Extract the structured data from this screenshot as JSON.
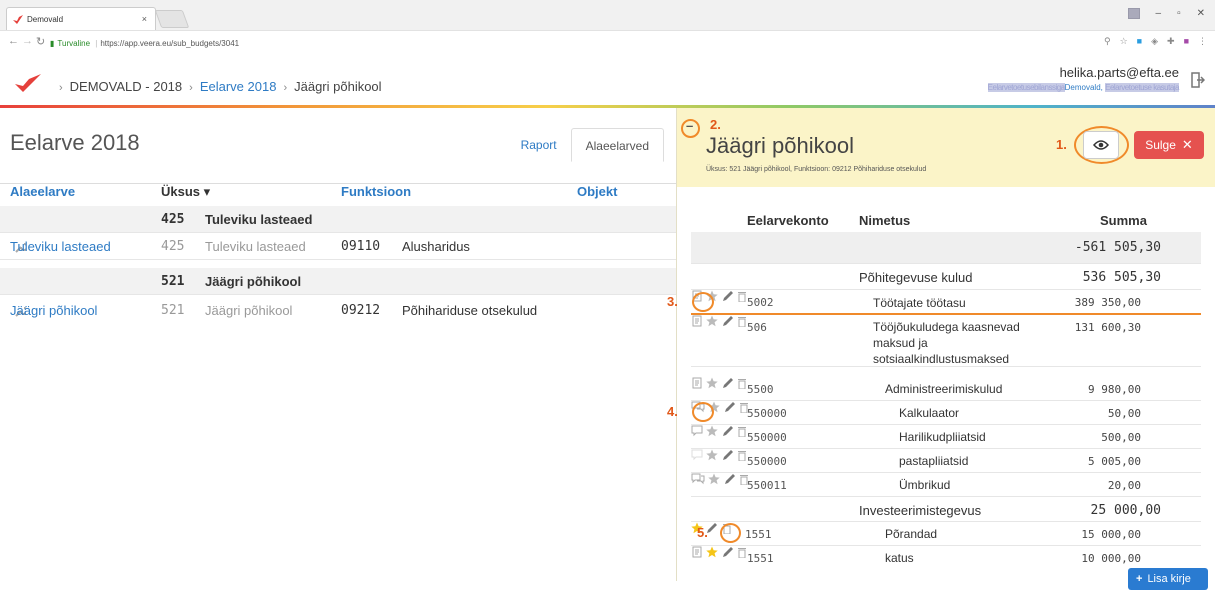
{
  "browser": {
    "tab_title": "Demovald",
    "tab_close": "×",
    "secure_label": "Turvaline",
    "url": "https://app.veera.eu/sub_budgets/3041"
  },
  "header": {
    "crumbs": [
      "DEMOVALD - 2018",
      "Eelarve 2018",
      "Jäägri põhikool"
    ],
    "user_email": "helika.parts@efta.ee",
    "user_org_blur_left": "Eelarvetoetusebilanssiga",
    "user_org": "Demovald,",
    "user_org_blur_right": "Eelarvetoetuse kasutaja"
  },
  "left": {
    "title": "Eelarve 2018",
    "tabs": [
      "Raport",
      "Alaeelarved"
    ],
    "columns": {
      "alaeelarve": "Alaeelarve",
      "uksus": "Üksus ▾",
      "funktsioon": "Funktsioon",
      "objekt": "Objekt"
    },
    "rows": [
      {
        "type": "group",
        "code": "425",
        "name": "Tuleviku lasteaed"
      },
      {
        "type": "item",
        "alaeelarve": "Tuleviku lasteaed",
        "code": "425",
        "name": "Tuleviku lasteaed",
        "fcode": "09110",
        "fname": "Alusharidus"
      },
      {
        "type": "group",
        "code": "521",
        "name": "Jäägri põhikool"
      },
      {
        "type": "item",
        "alaeelarve": "Jäägri põhikool",
        "code": "521",
        "name": "Jäägri põhikool",
        "fcode": "09212",
        "fname": "Põhihariduse otsekulud"
      }
    ]
  },
  "right": {
    "title": "Jäägri põhikool",
    "subtitle": "Üksus: 521 Jäägri põhikool, Funktsioon: 09212 Põhihariduse otsekulud",
    "close_label": "Sulge",
    "annotations": {
      "a1": "1.",
      "a2": "2.",
      "a3": "3.",
      "a4": "4.",
      "a5": "5."
    },
    "columns": {
      "konto": "Eelarvekonto",
      "nimetus": "Nimetus",
      "summa": "Summa"
    },
    "total": "-561 505,30",
    "group1": {
      "name": "Põhitegevuse kulud",
      "amount": "536 505,30"
    },
    "group2": {
      "name": "Investeerimistegevus",
      "amount": "25 000,00"
    },
    "rows": [
      {
        "code": "5002",
        "name": "Töötajate töötasu",
        "amount": "389 350,00",
        "icon": "document-icon",
        "starred": false
      },
      {
        "code": "506",
        "name": "Tööjõukuludega kaasnevad maksud ja sotsiaalkindlustusmaksed",
        "amount": "131 600,30",
        "icon": "document-icon",
        "starred": false
      },
      {
        "code": "5500",
        "name": "Administreerimiskulud",
        "amount": "9 980,00",
        "icon": "document-icon",
        "starred": false
      },
      {
        "code": "550000",
        "name": "Kalkulaator",
        "amount": "50,00",
        "icon": "comments-icon",
        "starred": false
      },
      {
        "code": "550000",
        "name": "Harilikudpliiatsid",
        "amount": "500,00",
        "icon": "comment-icon",
        "starred": false
      },
      {
        "code": "550000",
        "name": "pastapliiatsid",
        "amount": "5 005,00",
        "icon": "comment-empty-icon",
        "starred": false
      },
      {
        "code": "550011",
        "name": "Ümbrikud",
        "amount": "20,00",
        "icon": "comments-icon",
        "starred": false
      },
      {
        "code": "1551",
        "name": "Põrandad",
        "amount": "15 000,00",
        "icon": "none",
        "starred": true
      },
      {
        "code": "1551",
        "name": "katus",
        "amount": "10 000,00",
        "icon": "document-icon",
        "starred": true
      }
    ],
    "add_label": "Lisa kirje"
  }
}
